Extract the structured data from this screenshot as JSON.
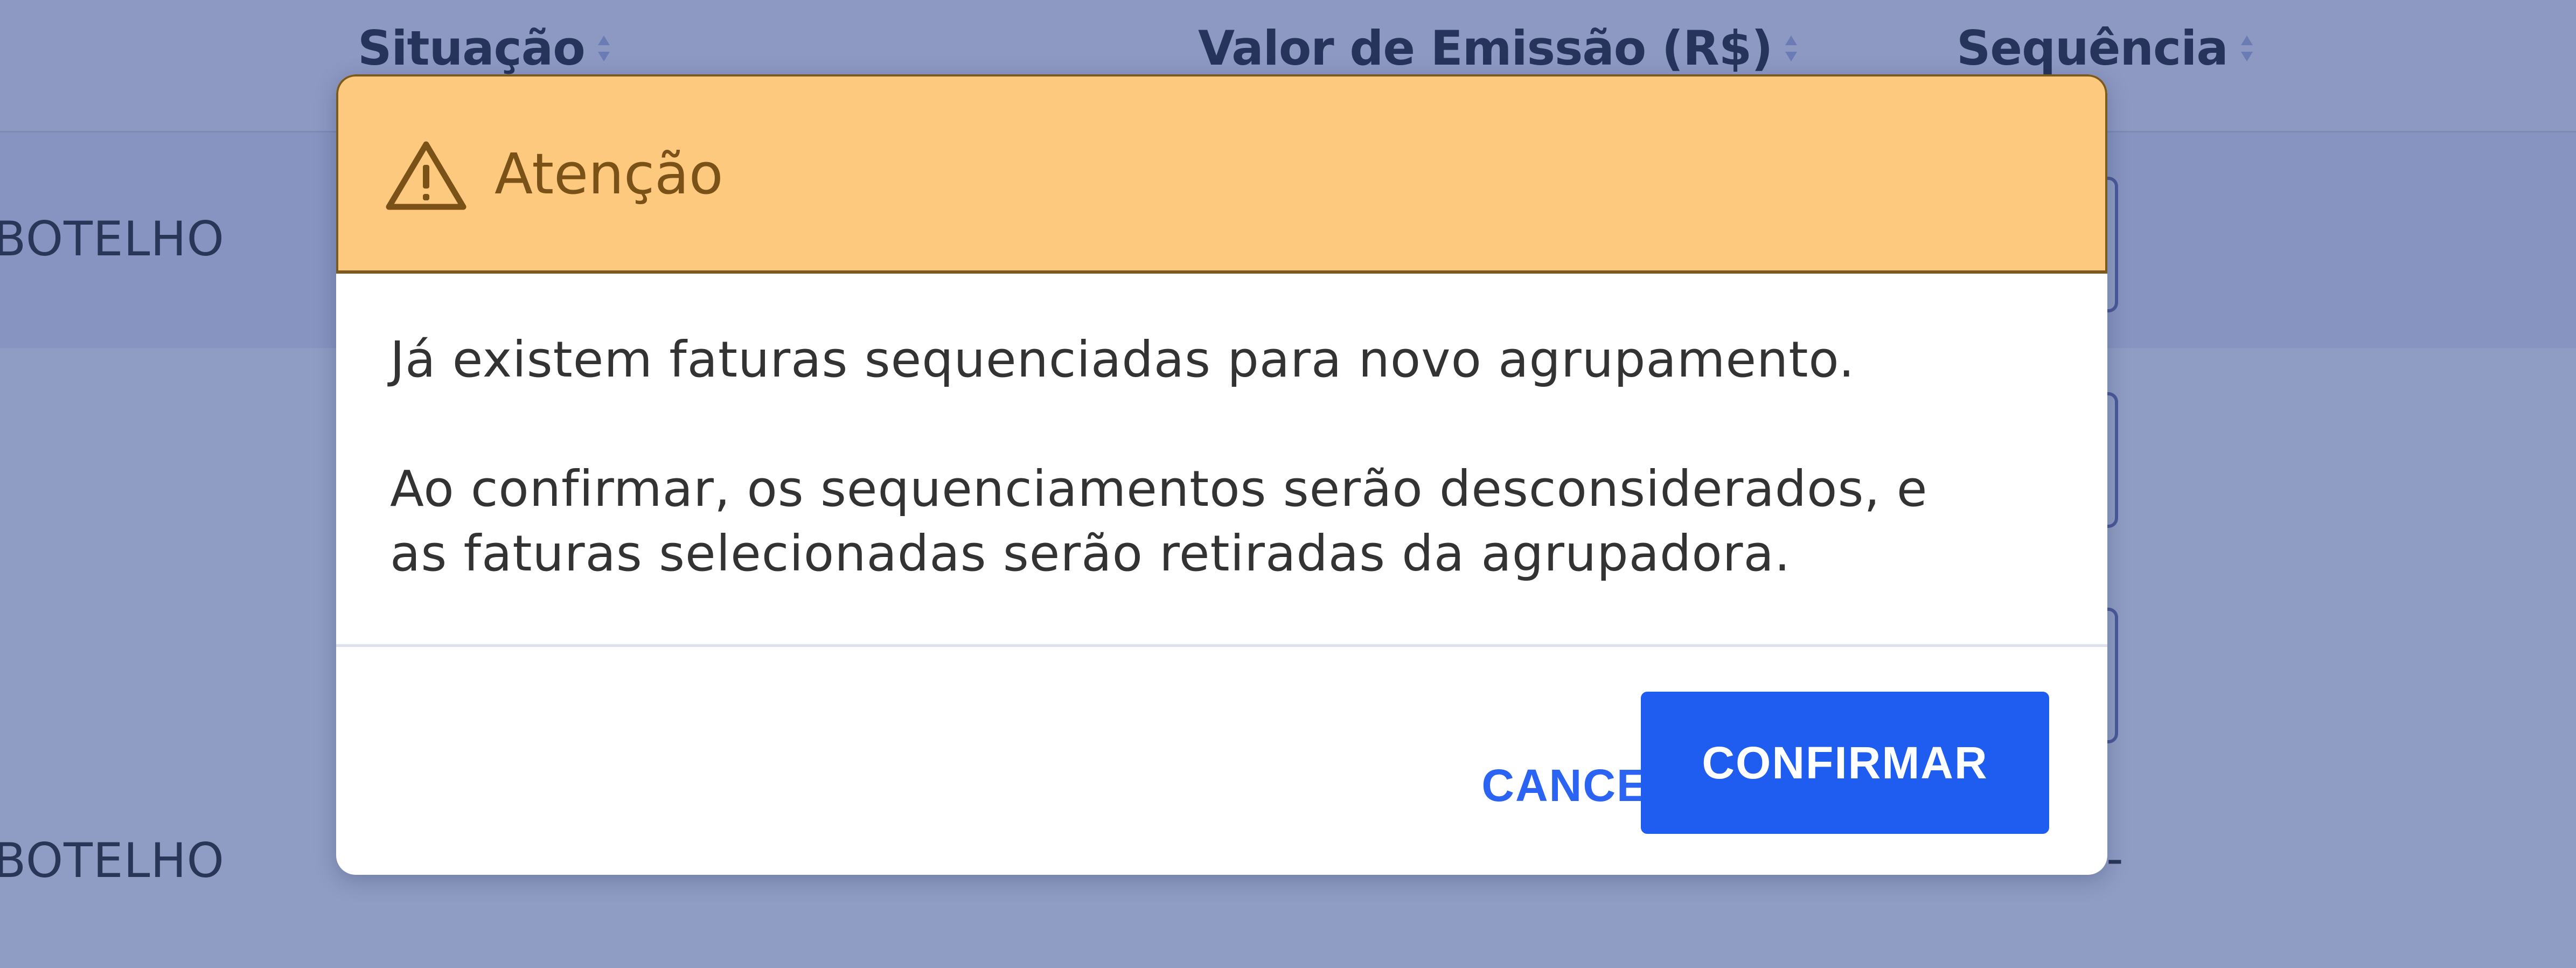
{
  "table": {
    "headers": {
      "situacao": "Situação",
      "valor_emissao": "Valor de Emissão (R$)",
      "sequencia": "Sequência"
    },
    "rows": [
      {
        "name_fragment": "BOTELHO"
      },
      {
        "name_fragment": ""
      },
      {
        "name_fragment": ""
      },
      {
        "name_fragment": "BOTELHO",
        "sequencia": "-"
      }
    ]
  },
  "dialog": {
    "title": "Atenção",
    "icon": "warning-triangle-icon",
    "message_1": "Já existem faturas sequenciadas para novo agrupamento.",
    "message_2_line_1": "Ao confirmar, os sequenciamentos serão desconsiderados, e",
    "message_2_line_2": "as faturas selecionadas serão retiradas da agrupadora.",
    "cancel_label": "CANCELAR",
    "confirm_label": "CONFIRMAR"
  },
  "colors": {
    "overlay_tint": "#8f9cc4",
    "header_warning": "#fdc97e",
    "primary": "#1f5cf0",
    "link": "#2b63f2"
  }
}
